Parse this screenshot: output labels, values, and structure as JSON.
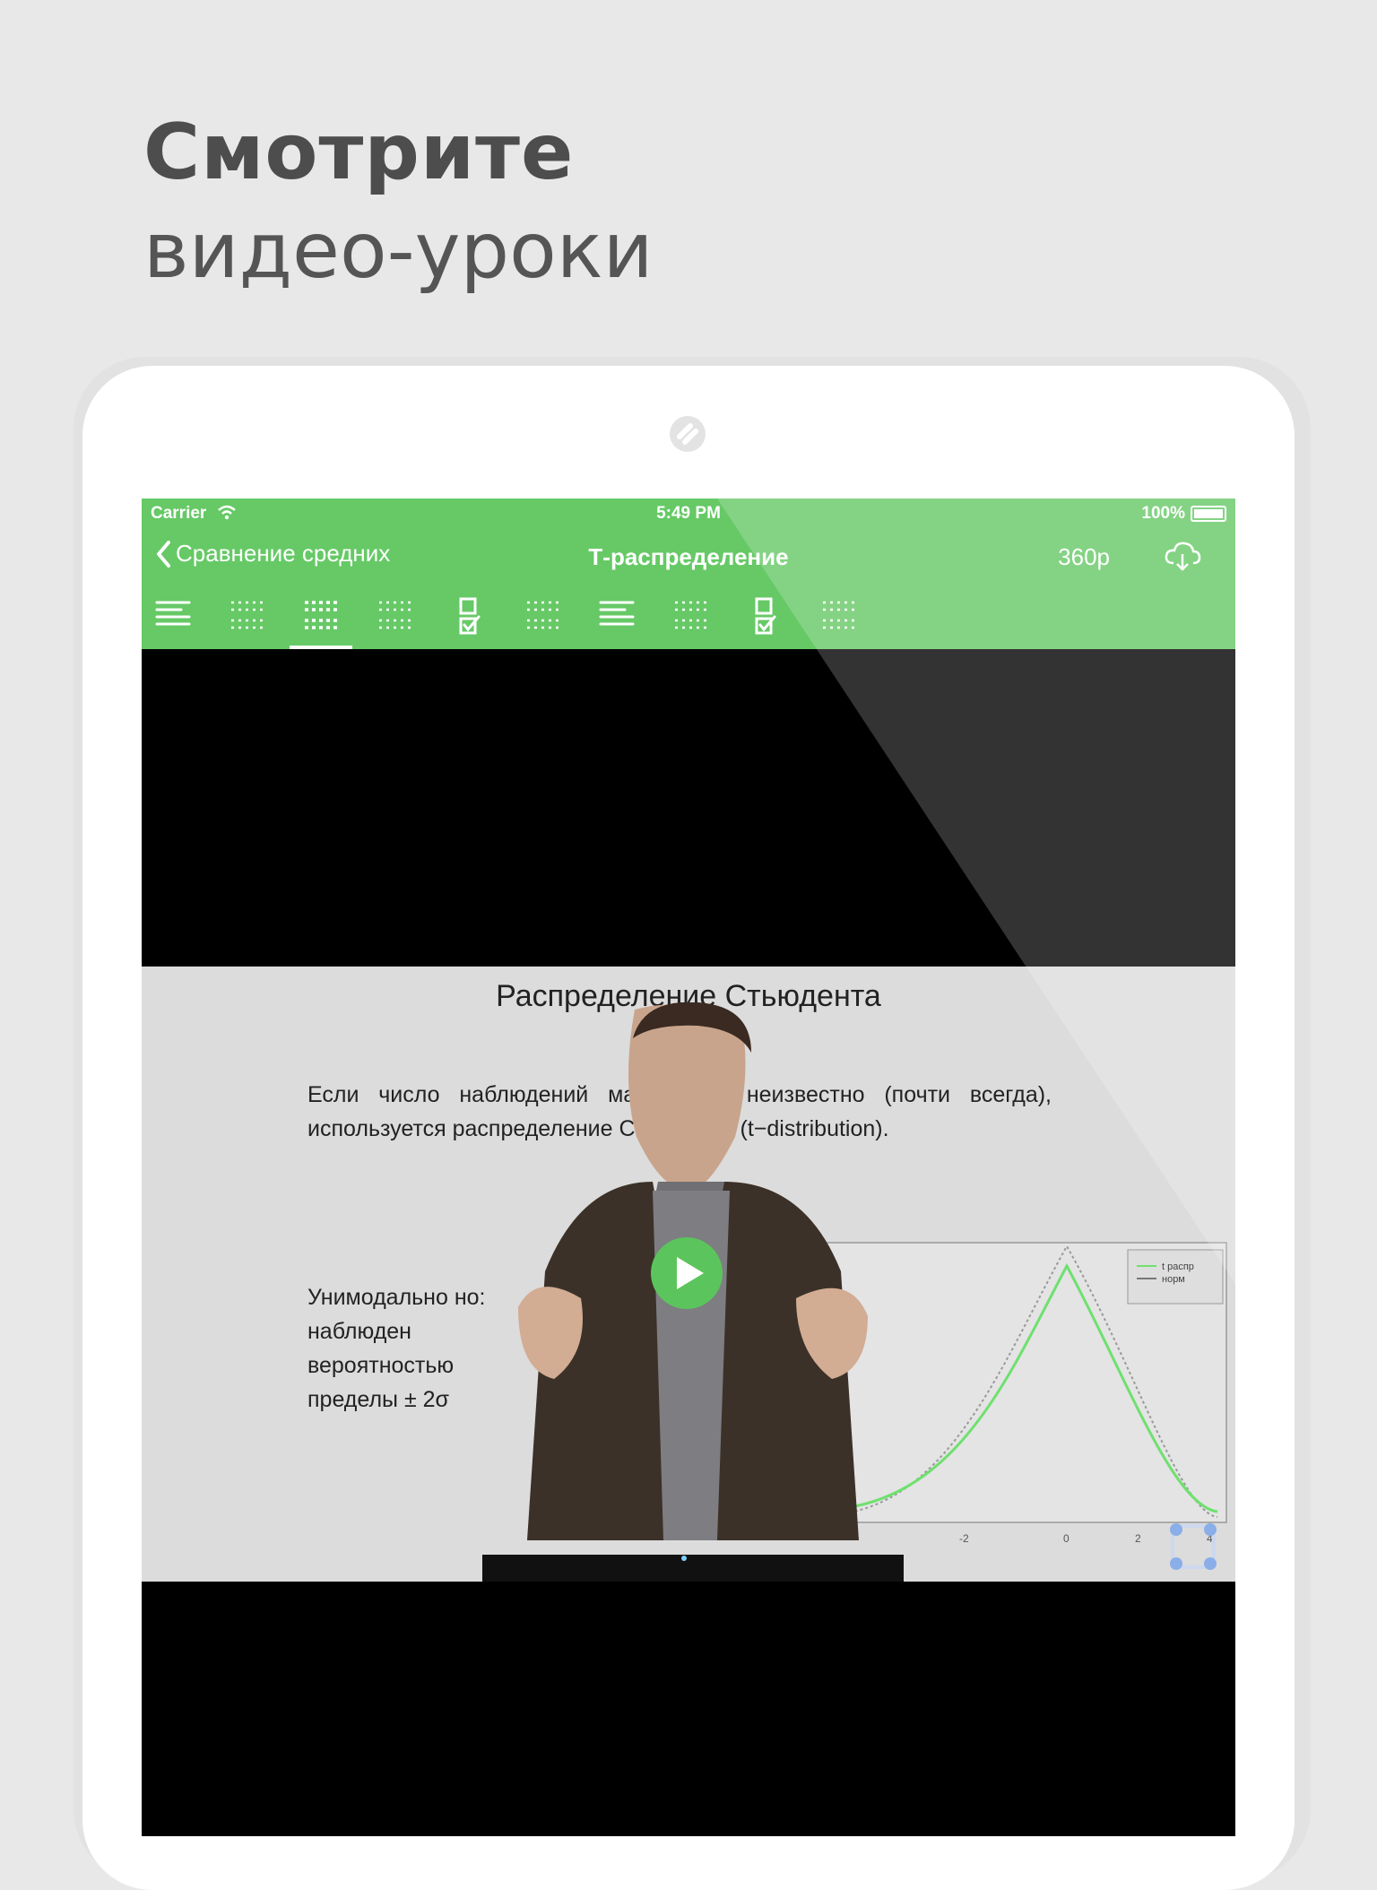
{
  "headline": {
    "line1": "Смотрите",
    "line2": "видео-уроки"
  },
  "statusbar": {
    "carrier": "Carrier",
    "time": "5:49 PM",
    "battery": "100%"
  },
  "navbar": {
    "back_label": "Сравнение средних",
    "title": "Т-распределение",
    "quality": "360p"
  },
  "tabs": [
    {
      "icon": "text-lines-icon",
      "active": false
    },
    {
      "icon": "dotted-lines-icon",
      "active": false
    },
    {
      "icon": "dotted-lines-icon",
      "active": true
    },
    {
      "icon": "dotted-lines-icon",
      "active": false
    },
    {
      "icon": "quiz-checkbox-icon",
      "active": false
    },
    {
      "icon": "dotted-lines-icon",
      "active": false
    },
    {
      "icon": "text-lines-icon",
      "active": false
    },
    {
      "icon": "dotted-lines-icon",
      "active": false
    },
    {
      "icon": "quiz-checkbox-icon",
      "active": false
    },
    {
      "icon": "dotted-lines-icon",
      "active": false
    }
  ],
  "slide": {
    "title": "Распределение Стьюдента",
    "paragraph1": "Если число наблюдений мало и σ неизвестно (почти всегда), используется распределение Стьюдента (t−distribution).",
    "paragraph2": "Унимодально но: наблюден вероятностью пределы ± 2σ",
    "plot_legend": [
      "t распр",
      "норм"
    ],
    "plot_ticks": [
      "-2",
      "0",
      "2",
      "4"
    ]
  },
  "colors": {
    "accent": "#66c966",
    "play": "#5cc45c",
    "background": "#e8e8e8"
  }
}
